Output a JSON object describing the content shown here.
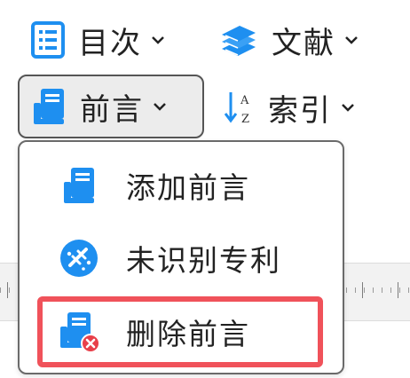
{
  "ribbon": {
    "toc_label": "目次",
    "references_label": "文献",
    "foreword_label": "前言",
    "index_label": "索引"
  },
  "foreword_menu": {
    "items": [
      {
        "label": "添加前言",
        "icon": "foreword-icon"
      },
      {
        "label": "未识别专利",
        "icon": "patent-icon"
      },
      {
        "label": "删除前言",
        "icon": "foreword-delete-icon",
        "highlighted": true
      }
    ]
  },
  "colors": {
    "accent_blue": "#1e8ff0",
    "highlight_red": "#f0525a",
    "delete_badge": "#e8404a"
  }
}
